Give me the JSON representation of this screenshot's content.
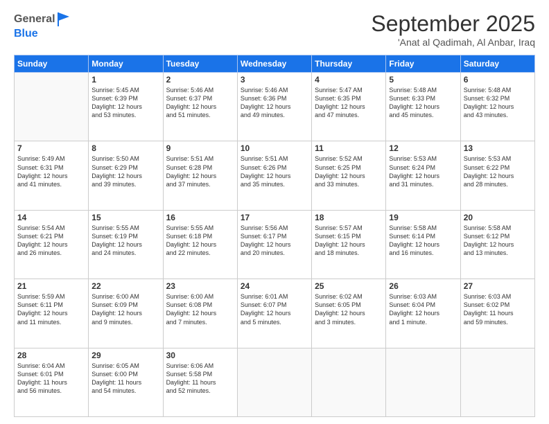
{
  "header": {
    "logo_general": "General",
    "logo_blue": "Blue",
    "month_title": "September 2025",
    "location": "'Anat al Qadimah, Al Anbar, Iraq"
  },
  "weekdays": [
    "Sunday",
    "Monday",
    "Tuesday",
    "Wednesday",
    "Thursday",
    "Friday",
    "Saturday"
  ],
  "weeks": [
    [
      {
        "day": "",
        "info": ""
      },
      {
        "day": "1",
        "info": "Sunrise: 5:45 AM\nSunset: 6:39 PM\nDaylight: 12 hours\nand 53 minutes."
      },
      {
        "day": "2",
        "info": "Sunrise: 5:46 AM\nSunset: 6:37 PM\nDaylight: 12 hours\nand 51 minutes."
      },
      {
        "day": "3",
        "info": "Sunrise: 5:46 AM\nSunset: 6:36 PM\nDaylight: 12 hours\nand 49 minutes."
      },
      {
        "day": "4",
        "info": "Sunrise: 5:47 AM\nSunset: 6:35 PM\nDaylight: 12 hours\nand 47 minutes."
      },
      {
        "day": "5",
        "info": "Sunrise: 5:48 AM\nSunset: 6:33 PM\nDaylight: 12 hours\nand 45 minutes."
      },
      {
        "day": "6",
        "info": "Sunrise: 5:48 AM\nSunset: 6:32 PM\nDaylight: 12 hours\nand 43 minutes."
      }
    ],
    [
      {
        "day": "7",
        "info": "Sunrise: 5:49 AM\nSunset: 6:31 PM\nDaylight: 12 hours\nand 41 minutes."
      },
      {
        "day": "8",
        "info": "Sunrise: 5:50 AM\nSunset: 6:29 PM\nDaylight: 12 hours\nand 39 minutes."
      },
      {
        "day": "9",
        "info": "Sunrise: 5:51 AM\nSunset: 6:28 PM\nDaylight: 12 hours\nand 37 minutes."
      },
      {
        "day": "10",
        "info": "Sunrise: 5:51 AM\nSunset: 6:26 PM\nDaylight: 12 hours\nand 35 minutes."
      },
      {
        "day": "11",
        "info": "Sunrise: 5:52 AM\nSunset: 6:25 PM\nDaylight: 12 hours\nand 33 minutes."
      },
      {
        "day": "12",
        "info": "Sunrise: 5:53 AM\nSunset: 6:24 PM\nDaylight: 12 hours\nand 31 minutes."
      },
      {
        "day": "13",
        "info": "Sunrise: 5:53 AM\nSunset: 6:22 PM\nDaylight: 12 hours\nand 28 minutes."
      }
    ],
    [
      {
        "day": "14",
        "info": "Sunrise: 5:54 AM\nSunset: 6:21 PM\nDaylight: 12 hours\nand 26 minutes."
      },
      {
        "day": "15",
        "info": "Sunrise: 5:55 AM\nSunset: 6:19 PM\nDaylight: 12 hours\nand 24 minutes."
      },
      {
        "day": "16",
        "info": "Sunrise: 5:55 AM\nSunset: 6:18 PM\nDaylight: 12 hours\nand 22 minutes."
      },
      {
        "day": "17",
        "info": "Sunrise: 5:56 AM\nSunset: 6:17 PM\nDaylight: 12 hours\nand 20 minutes."
      },
      {
        "day": "18",
        "info": "Sunrise: 5:57 AM\nSunset: 6:15 PM\nDaylight: 12 hours\nand 18 minutes."
      },
      {
        "day": "19",
        "info": "Sunrise: 5:58 AM\nSunset: 6:14 PM\nDaylight: 12 hours\nand 16 minutes."
      },
      {
        "day": "20",
        "info": "Sunrise: 5:58 AM\nSunset: 6:12 PM\nDaylight: 12 hours\nand 13 minutes."
      }
    ],
    [
      {
        "day": "21",
        "info": "Sunrise: 5:59 AM\nSunset: 6:11 PM\nDaylight: 12 hours\nand 11 minutes."
      },
      {
        "day": "22",
        "info": "Sunrise: 6:00 AM\nSunset: 6:09 PM\nDaylight: 12 hours\nand 9 minutes."
      },
      {
        "day": "23",
        "info": "Sunrise: 6:00 AM\nSunset: 6:08 PM\nDaylight: 12 hours\nand 7 minutes."
      },
      {
        "day": "24",
        "info": "Sunrise: 6:01 AM\nSunset: 6:07 PM\nDaylight: 12 hours\nand 5 minutes."
      },
      {
        "day": "25",
        "info": "Sunrise: 6:02 AM\nSunset: 6:05 PM\nDaylight: 12 hours\nand 3 minutes."
      },
      {
        "day": "26",
        "info": "Sunrise: 6:03 AM\nSunset: 6:04 PM\nDaylight: 12 hours\nand 1 minute."
      },
      {
        "day": "27",
        "info": "Sunrise: 6:03 AM\nSunset: 6:02 PM\nDaylight: 11 hours\nand 59 minutes."
      }
    ],
    [
      {
        "day": "28",
        "info": "Sunrise: 6:04 AM\nSunset: 6:01 PM\nDaylight: 11 hours\nand 56 minutes."
      },
      {
        "day": "29",
        "info": "Sunrise: 6:05 AM\nSunset: 6:00 PM\nDaylight: 11 hours\nand 54 minutes."
      },
      {
        "day": "30",
        "info": "Sunrise: 6:06 AM\nSunset: 5:58 PM\nDaylight: 11 hours\nand 52 minutes."
      },
      {
        "day": "",
        "info": ""
      },
      {
        "day": "",
        "info": ""
      },
      {
        "day": "",
        "info": ""
      },
      {
        "day": "",
        "info": ""
      }
    ]
  ]
}
